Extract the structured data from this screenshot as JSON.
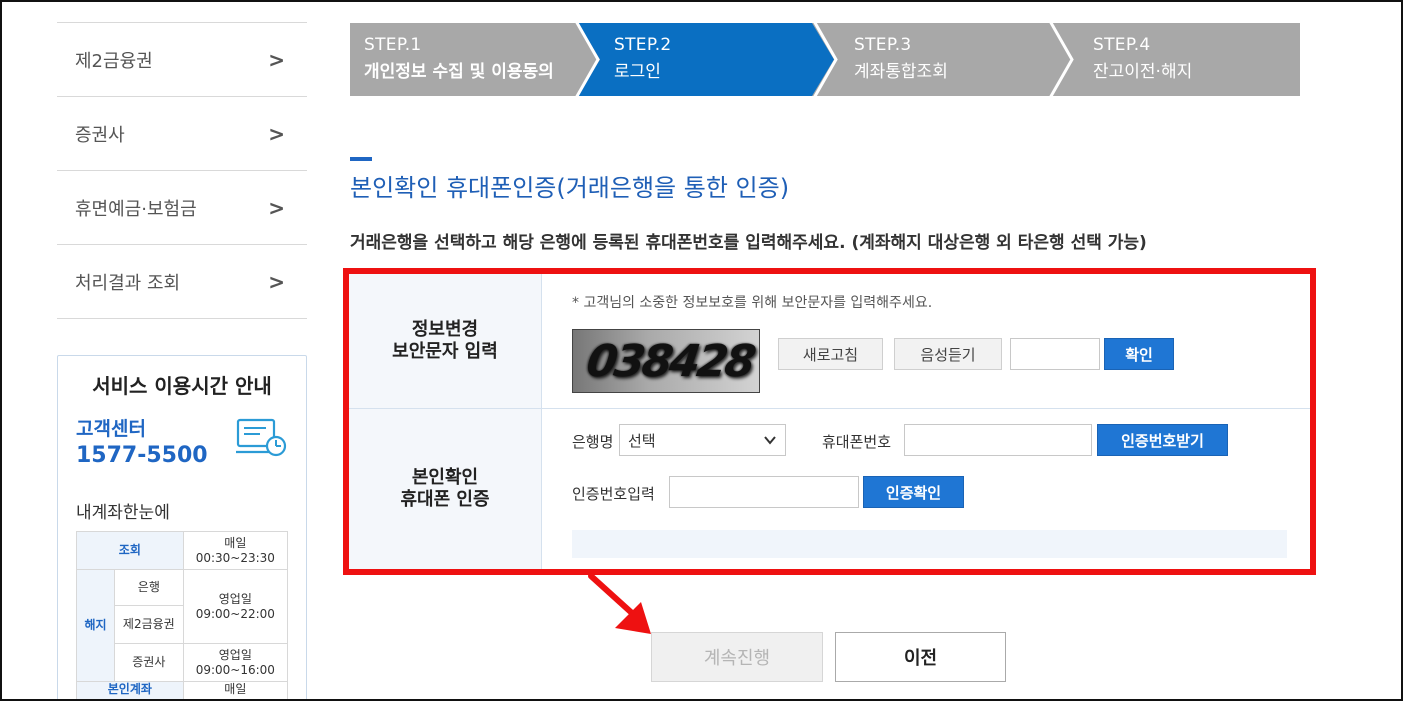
{
  "sidebar": {
    "items": [
      {
        "label": "제2금융권"
      },
      {
        "label": "증권사"
      },
      {
        "label": "휴면예금·보험금"
      },
      {
        "label": "처리결과 조회"
      }
    ],
    "chevron": ">",
    "info": {
      "title": "서비스 이용시간 안내",
      "center_label": "고객센터",
      "center_phone": "1577-5500",
      "account_label": "내계좌한눈에",
      "table": {
        "inquiry": "조회",
        "inquiry_days": "매일",
        "inquiry_time": "00:30~23:30",
        "cancel": "해지",
        "bank": "은행",
        "second": "제2금융권",
        "bank_days": "영업일",
        "bank_time": "09:00~22:00",
        "securities": "증권사",
        "sec_days": "영업일",
        "sec_time": "09:00~16:00",
        "self_account": "본인계좌",
        "self_days": "매일"
      }
    }
  },
  "steps": [
    {
      "num": "STEP.1",
      "label": "개인정보 수집 및 이용동의"
    },
    {
      "num": "STEP.2",
      "label": "로그인"
    },
    {
      "num": "STEP.3",
      "label": "계좌통합조회"
    },
    {
      "num": "STEP.4",
      "label": "잔고이전·해지"
    }
  ],
  "colors": {
    "step_active": "#0a6fc2",
    "step_inactive": "#a8a8a8",
    "accent": "#1f76d4",
    "highlight": "#ee1111"
  },
  "main": {
    "title": "본인확인 휴대폰인증(거래은행을 통한 인증)",
    "description": "거래은행을 선택하고 해당 은행에 등록된 휴대폰번호를 입력해주세요. (계좌해지 대상은행 외 타은행 선택 가능)"
  },
  "form": {
    "row1": {
      "head_line1": "정보변경",
      "head_line2": "보안문자 입력",
      "notice": "* 고객님의 소중한 정보보호를 위해 보안문자를 입력해주세요.",
      "captcha_text": "038428",
      "refresh_label": "새로고침",
      "audio_label": "음성듣기",
      "captcha_value": "",
      "confirm_label": "확인"
    },
    "row2": {
      "head_line1": "본인확인",
      "head_line2": "휴대폰 인증",
      "bank_label": "은행명",
      "bank_selected": "선택",
      "phone_label": "휴대폰번호",
      "phone_value": "",
      "get_code_label": "인증번호받기",
      "code_label": "인증번호입력",
      "code_value": "",
      "verify_label": "인증확인"
    }
  },
  "buttons": {
    "continue_label": "계속진행",
    "prev_label": "이전"
  }
}
